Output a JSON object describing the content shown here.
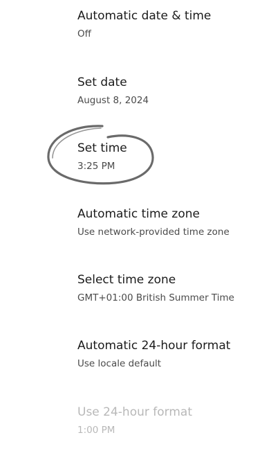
{
  "settings": {
    "items": [
      {
        "title": "Automatic date & time",
        "summary": "Off"
      },
      {
        "title": "Set date",
        "summary": "August 8, 2024"
      },
      {
        "title": "Set time",
        "summary": "3:25 PM"
      },
      {
        "title": "Automatic time zone",
        "summary": "Use network-provided time zone"
      },
      {
        "title": "Select time zone",
        "summary": "GMT+01:00 British Summer Time"
      },
      {
        "title": "Automatic 24-hour format",
        "summary": "Use locale default"
      },
      {
        "title": "Use 24-hour format",
        "summary": "1:00 PM"
      }
    ]
  },
  "colors": {
    "title_text": "#1b1b1b",
    "summary_text": "#4a4a4a",
    "disabled_text": "#b8b8b8",
    "annotation_stroke": "#6a6a6a"
  }
}
